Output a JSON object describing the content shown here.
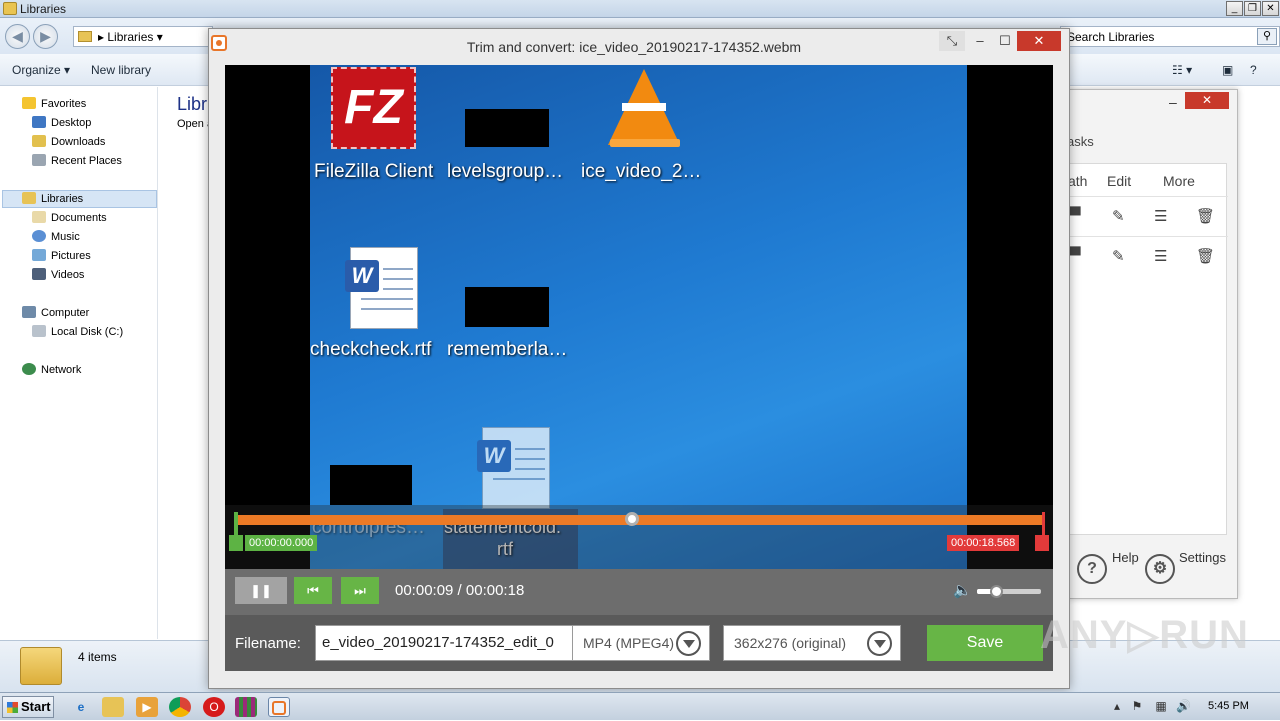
{
  "explorer": {
    "window_title": "Libraries",
    "address": "Libraries",
    "search_placeholder": "Search Libraries",
    "toolbar": {
      "organize": "Organize",
      "new_library": "New library"
    },
    "nav": {
      "favorites": "Favorites",
      "desktop": "Desktop",
      "downloads": "Downloads",
      "recent_places": "Recent Places",
      "libraries": "Libraries",
      "documents": "Documents",
      "music": "Music",
      "pictures": "Pictures",
      "videos": "Videos",
      "computer": "Computer",
      "local_disk": "Local Disk (C:)",
      "network": "Network"
    },
    "main_title": "Libr",
    "main_subtitle": "Open a",
    "status_count": "4 items"
  },
  "side_panel": {
    "tasks_label": "asks",
    "col_path": "ath",
    "col_edit": "Edit",
    "col_more": "More",
    "help": "Help",
    "settings": "Settings"
  },
  "dialog": {
    "title": "Trim and convert: ice_video_20190217-174352.webm",
    "video": {
      "desktop_icons": {
        "filezilla": "FileZilla Client",
        "levelsgroup": "levelsgroup…",
        "ice_video": "ice_video_2…",
        "checkcheck": "checkcheck.rtf",
        "rememberla": "rememberla…",
        "controlpres": "controlpres…",
        "statementcold_1": "statementcold.",
        "statementcold_2": "rtf"
      },
      "trim_start": "00:00:00.000",
      "trim_end": "00:00:18.568",
      "playhead_fraction": 0.49
    },
    "controls": {
      "time_display": "00:00:09 / 00:00:18",
      "volume_fraction": 0.3
    },
    "output": {
      "filename_label": "Filename:",
      "filename_value": "e_video_20190217-174352_edit_0",
      "format": "MP4 (MPEG4)",
      "resolution": "362x276 (original)",
      "save_label": "Save"
    }
  },
  "taskbar": {
    "start_label": "Start",
    "clock": "5:45 PM"
  },
  "watermark": "ANY▷RUN",
  "colors": {
    "accent_orange": "#ec7a26",
    "accent_green": "#67b546",
    "accent_red": "#e23a3a"
  }
}
